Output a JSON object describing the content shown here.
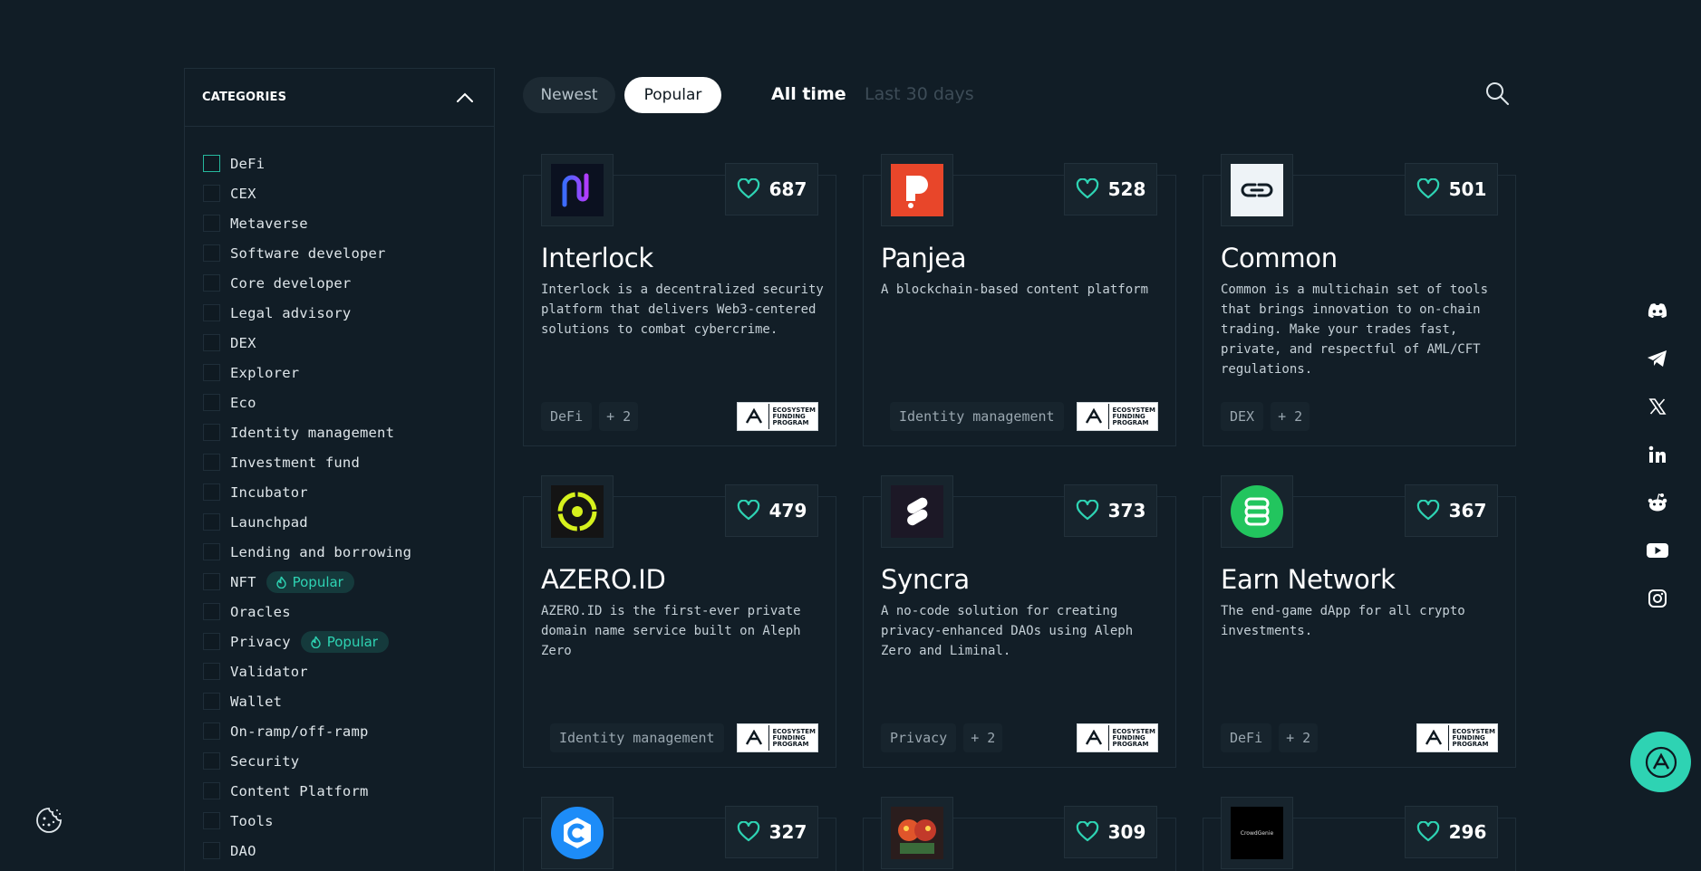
{
  "sidebar": {
    "title": "CATEGORIES",
    "popular_label": "Popular",
    "items": [
      {
        "label": "DeFi"
      },
      {
        "label": "CEX"
      },
      {
        "label": "Metaverse"
      },
      {
        "label": "Software developer"
      },
      {
        "label": "Core developer"
      },
      {
        "label": "Legal advisory"
      },
      {
        "label": "DEX"
      },
      {
        "label": "Explorer"
      },
      {
        "label": "Eco"
      },
      {
        "label": "Identity management"
      },
      {
        "label": "Investment fund"
      },
      {
        "label": "Incubator"
      },
      {
        "label": "Launchpad"
      },
      {
        "label": "Lending and borrowing"
      },
      {
        "label": "NFT",
        "popular": true
      },
      {
        "label": "Oracles"
      },
      {
        "label": "Privacy",
        "popular": true
      },
      {
        "label": "Validator"
      },
      {
        "label": "Wallet"
      },
      {
        "label": "On-ramp/off-ramp"
      },
      {
        "label": "Security"
      },
      {
        "label": "Content Platform"
      },
      {
        "label": "Tools"
      },
      {
        "label": "DAO"
      }
    ]
  },
  "sort": {
    "newest": "Newest",
    "popular": "Popular",
    "active": "Popular"
  },
  "period": {
    "all_time": "All time",
    "last_30": "Last 30 days",
    "active": "All time"
  },
  "efp_badge": [
    "ECOSYSTEM",
    "FUNDING",
    "PROGRAM"
  ],
  "cards": [
    {
      "name": "Interlock",
      "likes": "687",
      "desc": "Interlock is a decentralized security platform that delivers Web3-centered solutions to combat cybercrime.",
      "tag": "DeFi",
      "more": "+ 2",
      "logo_icon": "interlock-logo"
    },
    {
      "name": "Panjea",
      "likes": "528",
      "desc": "A blockchain-based content platform",
      "tag": "Identity management",
      "more": "",
      "logo_icon": "panjea-logo"
    },
    {
      "name": "Common",
      "likes": "501",
      "desc": "Common is a multichain set of tools that brings innovation to on-chain trading. Make your trades fast, private, and respectful of AML/CFT regulations.",
      "tag": "DEX",
      "more": "+ 2",
      "logo_icon": "common-logo"
    },
    {
      "name": "AZERO.ID",
      "likes": "479",
      "desc": "AZERO.ID is the first-ever private domain name service built on Aleph Zero",
      "tag": "Identity management",
      "more": "",
      "logo_icon": "azero-id-logo"
    },
    {
      "name": "Syncra",
      "likes": "373",
      "desc": "A no-code solution for creating privacy-enhanced DAOs using Aleph Zero and Liminal.",
      "tag": "Privacy",
      "more": "+ 2",
      "logo_icon": "syncra-logo"
    },
    {
      "name": "Earn Network",
      "likes": "367",
      "desc": "The end-game dApp for all crypto investments.",
      "tag": "DeFi",
      "more": "+ 2",
      "logo_icon": "earn-network-logo"
    },
    {
      "likes": "327",
      "logo_icon": "c-logo"
    },
    {
      "likes": "309",
      "logo_icon": "character-logo"
    },
    {
      "likes": "296",
      "logo_icon": "crowdgenie-logo",
      "logo_text": "CrowdGenie"
    }
  ],
  "socials": [
    "discord-icon",
    "telegram-icon",
    "x-icon",
    "linkedin-icon",
    "reddit-icon",
    "youtube-icon",
    "instagram-icon"
  ],
  "colors": {
    "background": "#111d26",
    "accent": "#2ed3b3",
    "card": "#121e27",
    "border": "#1f2e39"
  }
}
